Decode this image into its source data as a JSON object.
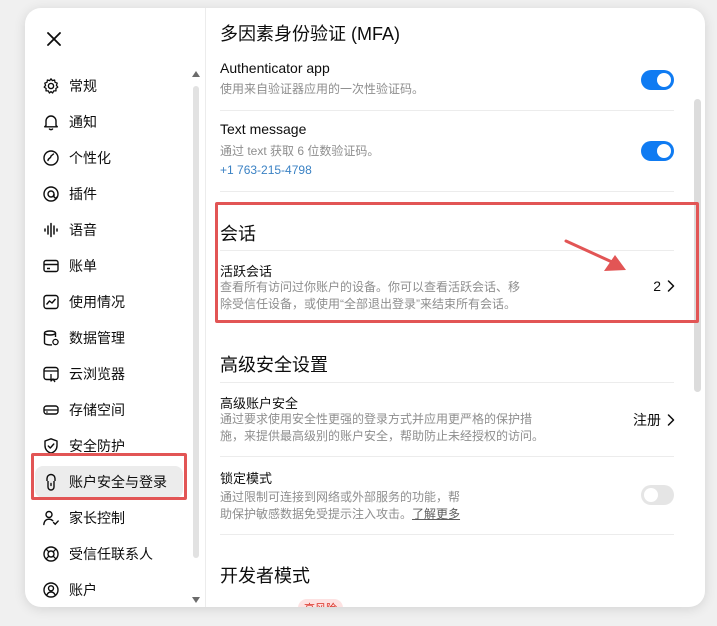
{
  "sidebar": {
    "items": [
      {
        "label": "常规",
        "icon": "gear-icon"
      },
      {
        "label": "通知",
        "icon": "bell-icon"
      },
      {
        "label": "个性化",
        "icon": "personalization-icon"
      },
      {
        "label": "插件",
        "icon": "plugin-icon"
      },
      {
        "label": "语音",
        "icon": "voice-wave-icon"
      },
      {
        "label": "账单",
        "icon": "billing-card-icon"
      },
      {
        "label": "使用情况",
        "icon": "usage-chart-icon"
      },
      {
        "label": "数据管理",
        "icon": "database-icon"
      },
      {
        "label": "云浏览器",
        "icon": "cloud-browser-icon"
      },
      {
        "label": "存储空间",
        "icon": "storage-drive-icon"
      },
      {
        "label": "安全防护",
        "icon": "shield-check-icon"
      },
      {
        "label": "账户安全与登录",
        "icon": "lock-account-icon"
      },
      {
        "label": "家长控制",
        "icon": "parental-control-icon"
      },
      {
        "label": "受信任联系人",
        "icon": "trusted-contact-icon"
      },
      {
        "label": "账户",
        "icon": "account-user-icon"
      }
    ],
    "active_index": 11
  },
  "mfa": {
    "title": "多因素身份验证 (MFA)",
    "authenticator": {
      "title": "Authenticator app",
      "desc": "使用来自验证器应用的一次性验证码。",
      "enabled": true
    },
    "text_message": {
      "title": "Text message",
      "desc": "通过 text 获取 6 位数验证码。",
      "phone": "+1 763-215-4798",
      "enabled": true
    }
  },
  "sessions": {
    "title": "会话",
    "active": {
      "title": "活跃会话",
      "desc_line1": "查看所有访问过你账户的设备。你可以查看活跃会话、移",
      "desc_line2": "除受信任设备，或使用“全部退出登录”来结束所有会话。",
      "count": "2"
    }
  },
  "advanced": {
    "title": "高级安全设置",
    "account_security": {
      "title": "高级账户安全",
      "desc_line1": "通过要求使用安全性更强的登录方式并应用更严格的保护措",
      "desc_line2": "施，来提供最高级别的账户安全，帮助防止未经授权的访问。",
      "action": "注册"
    },
    "lockdown": {
      "title": "锁定模式",
      "desc_line1": "通过限制可连接到网络或外部服务的功能，帮",
      "desc_line2": "助保护敏感数据免受提示注入攻击。",
      "learn_more": "了解更多",
      "enabled": false
    }
  },
  "developer": {
    "title": "开发者模式",
    "badge": "高风险"
  },
  "colors": {
    "accent_blue": "#0f7bf2",
    "annotation_red": "#e25555",
    "link_blue": "#3b82c4"
  }
}
